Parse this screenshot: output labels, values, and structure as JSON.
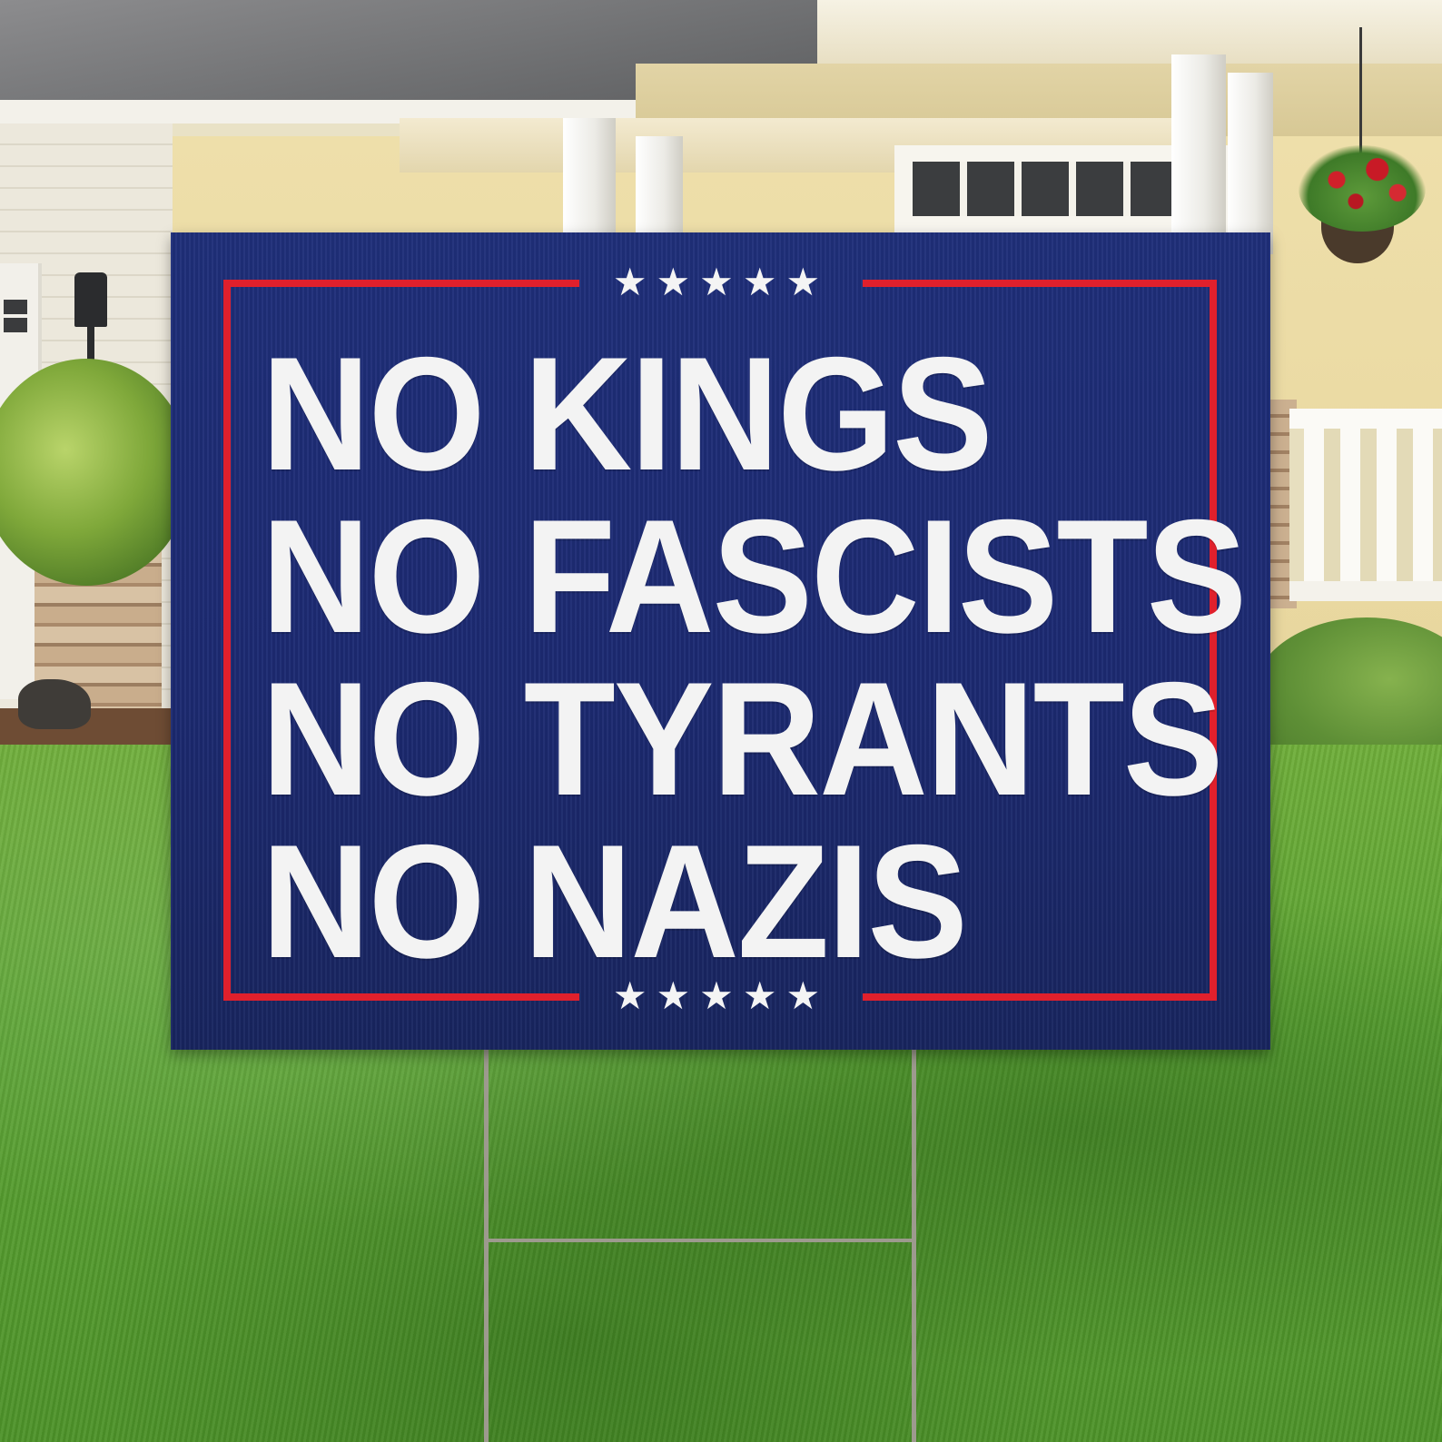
{
  "sign": {
    "lines": [
      "NO KINGS",
      "NO FASCISTS",
      "NO TYRANTS",
      "NO NAZIS"
    ],
    "top_stars": "★★★★★",
    "bottom_stars": "★★★★★"
  },
  "colors": {
    "sign_blue": "#1f2f7a",
    "border_red": "#e0202c",
    "text_white": "#f3f3f3",
    "lawn_green": "#5aa232"
  }
}
